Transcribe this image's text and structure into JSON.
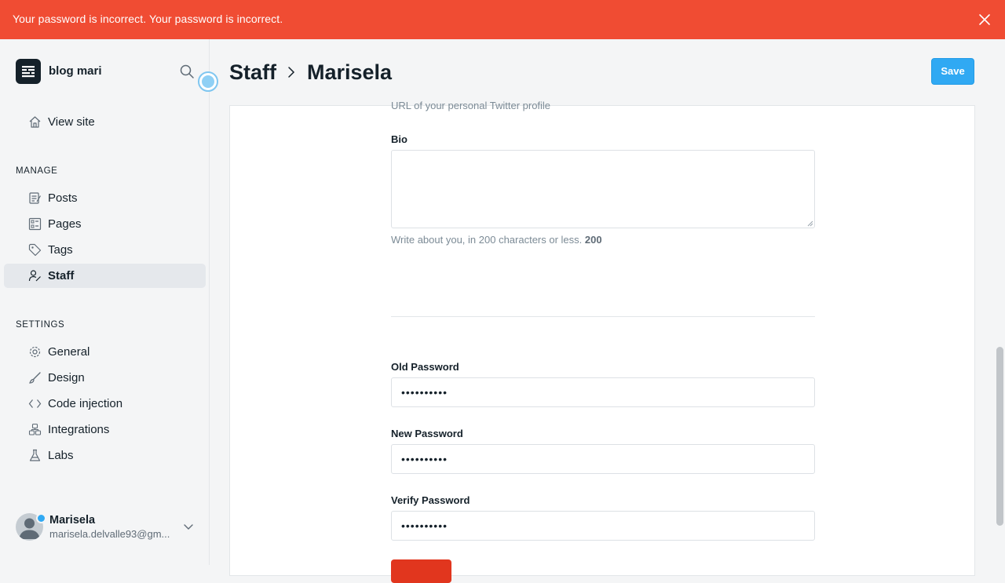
{
  "alert": {
    "message": "Your password is incorrect. Your password is incorrect.",
    "color": "#f04c33",
    "close_icon": "close-icon"
  },
  "sidebar": {
    "site_title": "blog mari",
    "view_site": "View site",
    "manage_heading": "MANAGE",
    "manage_items": [
      {
        "label": "Posts",
        "icon": "posts-icon"
      },
      {
        "label": "Pages",
        "icon": "pages-icon"
      },
      {
        "label": "Tags",
        "icon": "tag-icon"
      },
      {
        "label": "Staff",
        "icon": "staff-icon",
        "active": true
      }
    ],
    "settings_heading": "SETTINGS",
    "settings_items": [
      {
        "label": "General",
        "icon": "gear-icon"
      },
      {
        "label": "Design",
        "icon": "brush-icon"
      },
      {
        "label": "Code injection",
        "icon": "code-icon"
      },
      {
        "label": "Integrations",
        "icon": "integrations-icon"
      },
      {
        "label": "Labs",
        "icon": "flask-icon"
      }
    ],
    "user": {
      "name": "Marisela",
      "email": "marisela.delvalle93@gm..."
    }
  },
  "header": {
    "breadcrumb_parent": "Staff",
    "breadcrumb_current": "Marisela",
    "save_label": "Save",
    "accent": "#30a9f3"
  },
  "form": {
    "cut_hint": "URL of your personal Twitter profile",
    "bio_label": "Bio",
    "bio_value": "",
    "bio_hint": "Write about you, in 200 characters or less.",
    "bio_count": "200",
    "old_password_label": "Old Password",
    "old_password_value": "••••••••••",
    "new_password_label": "New Password",
    "new_password_value": "••••••••••",
    "verify_password_label": "Verify Password",
    "verify_password_value": "••••••••••"
  }
}
